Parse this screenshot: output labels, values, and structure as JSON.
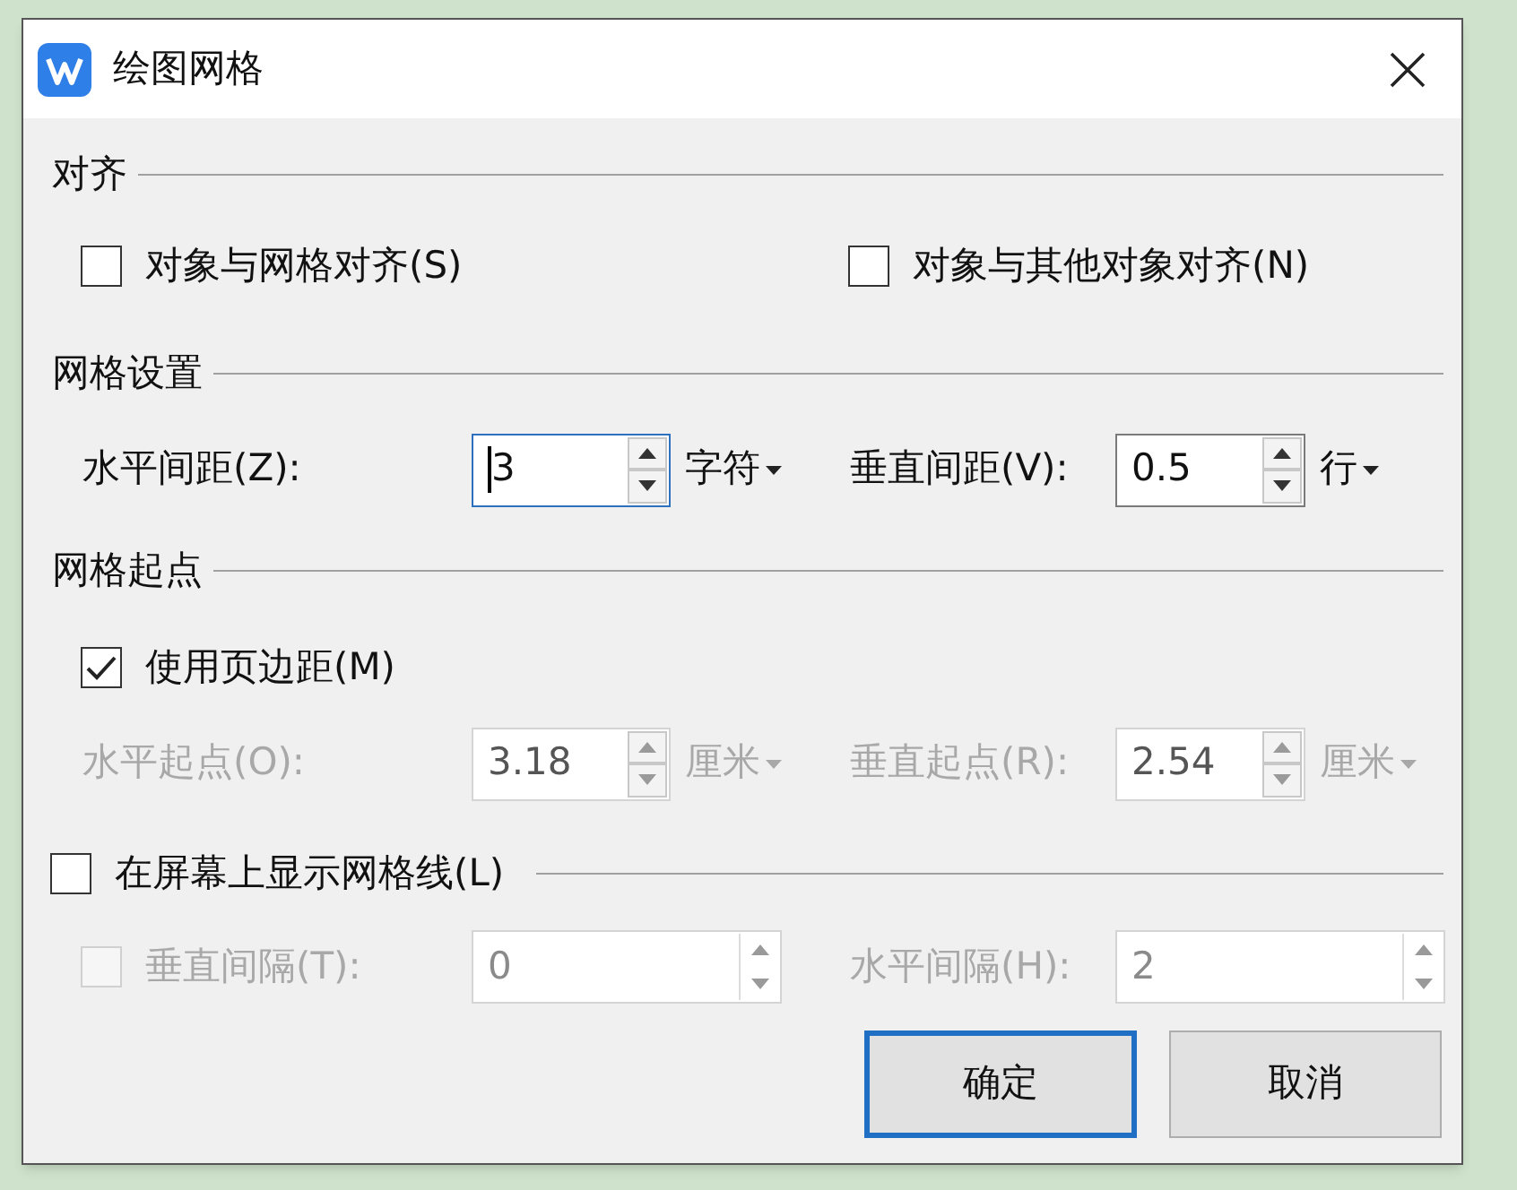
{
  "window": {
    "title": "绘图网格"
  },
  "alignment": {
    "title": "对齐",
    "items": [
      {
        "label": "对象与网格对齐(S)",
        "checked": false,
        "disabled": false
      },
      {
        "label": "对象与其他对象对齐(N)",
        "checked": false,
        "disabled": false
      }
    ]
  },
  "grid_settings": {
    "title": "网格设置",
    "fields": [
      {
        "label": "水平间距(Z):",
        "value": "3",
        "unit": "字符",
        "focused": true,
        "disabled": false
      },
      {
        "label": "垂直间距(V):",
        "value": "0.5",
        "unit": "行",
        "focused": false,
        "disabled": false
      }
    ]
  },
  "origin": {
    "title": "网格起点",
    "use_margins": {
      "label": "使用页边距(M)",
      "checked": true,
      "disabled": false
    },
    "fields": [
      {
        "label": "水平起点(O):",
        "value": "3.18",
        "unit": "厘米",
        "focused": false,
        "disabled": true
      },
      {
        "label": "垂直起点(R):",
        "value": "2.54",
        "unit": "厘米",
        "focused": false,
        "disabled": true
      }
    ]
  },
  "display": {
    "show_gridlines": {
      "label": "在屏幕上显示网格线(L)",
      "checked": false,
      "disabled": false
    },
    "vertical_every": {
      "label": "垂直间隔(T):",
      "checked": false,
      "disabled": true,
      "focused": false,
      "value": "0"
    },
    "horizontal_every": {
      "label": "水平间隔(H):",
      "disabled": true,
      "focused": false,
      "value": "2"
    }
  },
  "buttons": [
    {
      "label": "确定",
      "default": true
    },
    {
      "label": "取消",
      "default": false
    }
  ]
}
